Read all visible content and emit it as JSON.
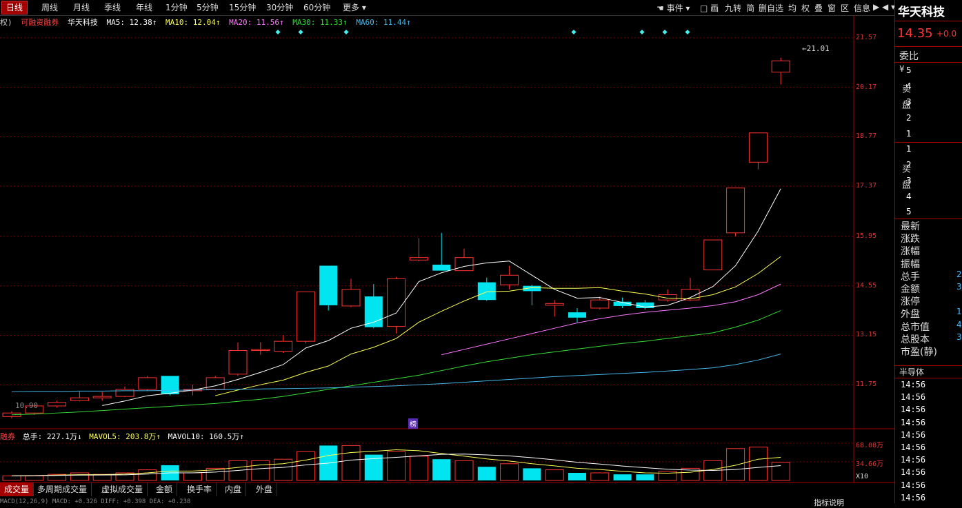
{
  "toolbar": {
    "periods": [
      "日线",
      "周线",
      "月线",
      "季线",
      "年线",
      "1分钟",
      "5分钟",
      "15分钟",
      "30分钟",
      "60分钟",
      "更多 ▾"
    ],
    "tools": [
      "事件 ▾",
      "□ 画",
      "九转",
      "简",
      "删自选",
      "均",
      "权",
      "叠",
      "窗",
      "区",
      "信息",
      "▶ ◀ ▾"
    ]
  },
  "stock": {
    "name": "华天科技",
    "price": "14.35",
    "change": "+0.0"
  },
  "infoline": {
    "prefix": "权)",
    "tag": "可融资融券",
    "name": "华天科技",
    "ma5": "MA5: 12.38↑",
    "ma10": "MA10: 12.04↑",
    "ma20": "MA20: 11.56↑",
    "ma30": "MA30: 11.33↑",
    "ma60": "MA60: 11.44↑"
  },
  "price_axis": [
    "21.57",
    "20.17",
    "18.77",
    "17.37",
    "15.95",
    "14.55",
    "13.15",
    "11.75"
  ],
  "annotations": {
    "high": "21.01",
    "low": "10.90",
    "badge": "榜"
  },
  "volume_info": {
    "prefix": "融券",
    "total": "总手: 227.1万↓",
    "mavol5": "MAVOL5: 203.8万↑",
    "mavol10": "MAVOL10: 160.5万↑"
  },
  "volume_axis": [
    "68.08万",
    "34.66万",
    "X10"
  ],
  "bottom_tabs": [
    "成交量",
    "多周期成交量",
    "虚拟成交量",
    "金额",
    "换手率",
    "内盘",
    "外盘"
  ],
  "bottom_right": "指标说明",
  "macd_text": "MACD(12,26,9) MACD: +0.326 DIFF: +0.398 DEA: +0.238",
  "right_panel": {
    "weibi": "委比",
    "yen": "¥",
    "sell_label": "卖盘",
    "sell_levels": [
      "5",
      "4",
      "3",
      "2",
      "1"
    ],
    "buy_label": "买盘",
    "buy_levels": [
      "1",
      "2",
      "3",
      "4",
      "5"
    ],
    "quote_labels": [
      "最新",
      "涨跌",
      "涨幅",
      "振幅",
      "总手",
      "金额",
      "涨停",
      "外盘",
      "总市值",
      "总股本",
      "市盈(静)"
    ],
    "quote_values": [
      "",
      "",
      "",
      "",
      "2",
      "3",
      "",
      "1",
      "4",
      "3",
      ""
    ],
    "sector": "半导体",
    "times": [
      "14:56",
      "14:56",
      "14:56",
      "14:56",
      "14:56",
      "14:56",
      "14:56",
      "14:56",
      "14:56",
      "14:56"
    ]
  },
  "chart_data": {
    "type": "candlestick",
    "candles": [
      {
        "o": 10.85,
        "c": 10.95,
        "h": 11.0,
        "l": 10.8
      },
      {
        "o": 10.95,
        "c": 11.15,
        "h": 11.2,
        "l": 10.9
      },
      {
        "o": 11.15,
        "c": 11.25,
        "h": 11.3,
        "l": 11.1
      },
      {
        "o": 11.3,
        "c": 11.38,
        "h": 11.55,
        "l": 11.28
      },
      {
        "o": 11.38,
        "c": 11.42,
        "h": 11.55,
        "l": 11.3
      },
      {
        "o": 11.42,
        "c": 11.62,
        "h": 11.7,
        "l": 11.4
      },
      {
        "o": 11.62,
        "c": 11.95,
        "h": 12.0,
        "l": 11.58
      },
      {
        "o": 12.0,
        "c": 11.48,
        "h": 12.0,
        "l": 11.45
      },
      {
        "o": 11.58,
        "c": 11.62,
        "h": 11.75,
        "l": 11.45
      },
      {
        "o": 11.62,
        "c": 11.95,
        "h": 12.0,
        "l": 11.58
      },
      {
        "o": 12.05,
        "c": 12.72,
        "h": 12.95,
        "l": 12.0
      },
      {
        "o": 12.72,
        "c": 12.75,
        "h": 12.95,
        "l": 12.6
      },
      {
        "o": 12.7,
        "c": 12.98,
        "h": 13.15,
        "l": 12.65
      },
      {
        "o": 12.98,
        "c": 14.38,
        "h": 14.38,
        "l": 12.92
      },
      {
        "o": 15.12,
        "c": 14.0,
        "h": 15.12,
        "l": 13.85
      },
      {
        "o": 13.98,
        "c": 14.45,
        "h": 14.75,
        "l": 13.95
      },
      {
        "o": 14.25,
        "c": 13.38,
        "h": 14.6,
        "l": 13.35
      },
      {
        "o": 13.4,
        "c": 14.75,
        "h": 14.8,
        "l": 13.2
      },
      {
        "o": 15.28,
        "c": 15.35,
        "h": 15.9,
        "l": 15.25
      },
      {
        "o": 15.15,
        "c": 14.98,
        "h": 16.05,
        "l": 14.98
      },
      {
        "o": 14.98,
        "c": 15.35,
        "h": 15.6,
        "l": 14.98
      },
      {
        "o": 14.65,
        "c": 14.15,
        "h": 14.78,
        "l": 14.12
      },
      {
        "o": 14.58,
        "c": 14.85,
        "h": 15.12,
        "l": 14.45
      },
      {
        "o": 14.55,
        "c": 14.4,
        "h": 14.58,
        "l": 14.0
      },
      {
        "o": 14.0,
        "c": 14.05,
        "h": 14.15,
        "l": 13.68
      },
      {
        "o": 13.8,
        "c": 13.65,
        "h": 13.92,
        "l": 13.52
      },
      {
        "o": 13.92,
        "c": 14.15,
        "h": 14.25,
        "l": 13.88
      },
      {
        "o": 14.1,
        "c": 13.98,
        "h": 14.22,
        "l": 13.92
      },
      {
        "o": 14.08,
        "c": 13.92,
        "h": 14.15,
        "l": 13.88
      },
      {
        "o": 14.15,
        "c": 14.3,
        "h": 14.45,
        "l": 14.1
      },
      {
        "o": 14.15,
        "c": 14.45,
        "h": 14.78,
        "l": 14.12
      },
      {
        "o": 15.0,
        "c": 15.85,
        "h": 15.85,
        "l": 15.0
      },
      {
        "o": 16.05,
        "c": 17.32,
        "h": 17.32,
        "l": 15.95
      },
      {
        "o": 18.05,
        "c": 18.88,
        "h": 18.88,
        "l": 17.85
      },
      {
        "o": 20.6,
        "c": 20.92,
        "h": 21.01,
        "l": 20.25
      }
    ],
    "ma": [
      {
        "name": "MA5",
        "color": "#ffffff",
        "values": [
          null,
          null,
          null,
          null,
          11.16,
          11.29,
          11.44,
          11.51,
          11.6,
          11.72,
          11.9,
          12.1,
          12.32,
          12.79,
          13.0,
          13.35,
          13.52,
          13.78,
          14.67,
          14.92,
          15.1,
          15.2,
          15.25,
          14.85,
          14.45,
          14.2,
          14.22,
          14.08,
          13.95,
          14.0,
          14.22,
          14.53,
          15.12,
          16.1,
          17.3
        ]
      },
      {
        "name": "MA10",
        "color": "#ffff55",
        "values": [
          null,
          null,
          null,
          null,
          null,
          null,
          null,
          null,
          null,
          11.44,
          11.6,
          11.75,
          11.88,
          12.1,
          12.28,
          12.62,
          12.81,
          13.06,
          13.52,
          13.83,
          14.12,
          14.38,
          14.4,
          14.5,
          14.48,
          14.48,
          14.5,
          14.4,
          14.32,
          14.2,
          14.18,
          14.3,
          14.52,
          14.9,
          15.38
        ]
      },
      {
        "name": "MA20",
        "color": "#ff77ff",
        "values": [
          null,
          null,
          null,
          null,
          null,
          null,
          null,
          null,
          null,
          null,
          null,
          null,
          null,
          null,
          null,
          null,
          null,
          null,
          null,
          12.6,
          12.75,
          12.9,
          13.05,
          13.2,
          13.35,
          13.5,
          13.62,
          13.72,
          13.8,
          13.86,
          13.92,
          13.99,
          14.1,
          14.3,
          14.6
        ]
      },
      {
        "name": "MA30",
        "color": "#33dd33",
        "values": [
          10.9,
          10.92,
          10.95,
          10.98,
          11.02,
          11.06,
          11.1,
          11.14,
          11.18,
          11.22,
          11.28,
          11.34,
          11.42,
          11.52,
          11.62,
          11.72,
          11.82,
          11.92,
          12.02,
          12.15,
          12.28,
          12.4,
          12.5,
          12.6,
          12.68,
          12.76,
          12.84,
          12.92,
          12.98,
          13.06,
          13.14,
          13.22,
          13.38,
          13.58,
          13.85
        ]
      },
      {
        "name": "MA60",
        "color": "#44bbee",
        "values": [
          11.55,
          11.56,
          11.56,
          11.57,
          11.57,
          11.58,
          11.58,
          11.59,
          11.6,
          11.61,
          11.62,
          11.63,
          11.64,
          11.65,
          11.66,
          11.68,
          11.7,
          11.72,
          11.75,
          11.78,
          11.82,
          11.86,
          11.9,
          11.94,
          11.98,
          12.01,
          12.04,
          12.07,
          12.1,
          12.14,
          12.18,
          12.23,
          12.32,
          12.45,
          12.62
        ]
      }
    ],
    "volumes": [
      0.3,
      0.3,
      0.4,
      0.5,
      0.4,
      0.5,
      0.7,
      1.0,
      0.5,
      0.8,
      1.3,
      1.3,
      1.4,
      1.9,
      2.3,
      2.3,
      1.7,
      1.9,
      1.6,
      1.4,
      1.3,
      0.9,
      1.1,
      0.8,
      0.7,
      0.5,
      0.5,
      0.4,
      0.4,
      0.6,
      0.8,
      1.3,
      2.1,
      2.2,
      1.2
    ],
    "mavol": [
      {
        "name": "MAVOL5",
        "color": "#ffff55",
        "values": [
          0.3,
          0.32,
          0.35,
          0.38,
          0.38,
          0.42,
          0.5,
          0.62,
          0.62,
          0.7,
          0.86,
          1.02,
          1.1,
          1.34,
          1.64,
          1.84,
          1.92,
          2.02,
          1.96,
          1.78,
          1.6,
          1.42,
          1.28,
          1.1,
          0.96,
          0.8,
          0.72,
          0.6,
          0.5,
          0.48,
          0.54,
          0.72,
          1.0,
          1.4,
          1.52
        ]
      },
      {
        "name": "MAVOL10",
        "color": "#ffffff",
        "values": [
          0.3,
          0.31,
          0.33,
          0.35,
          0.36,
          0.37,
          0.42,
          0.5,
          0.5,
          0.55,
          0.66,
          0.78,
          0.86,
          1.02,
          1.14,
          1.34,
          1.44,
          1.52,
          1.62,
          1.72,
          1.74,
          1.68,
          1.62,
          1.5,
          1.36,
          1.2,
          1.08,
          0.95,
          0.84,
          0.74,
          0.68,
          0.66,
          0.72,
          0.86,
          0.98
        ]
      }
    ],
    "ylim": [
      10.7,
      21.9
    ]
  }
}
